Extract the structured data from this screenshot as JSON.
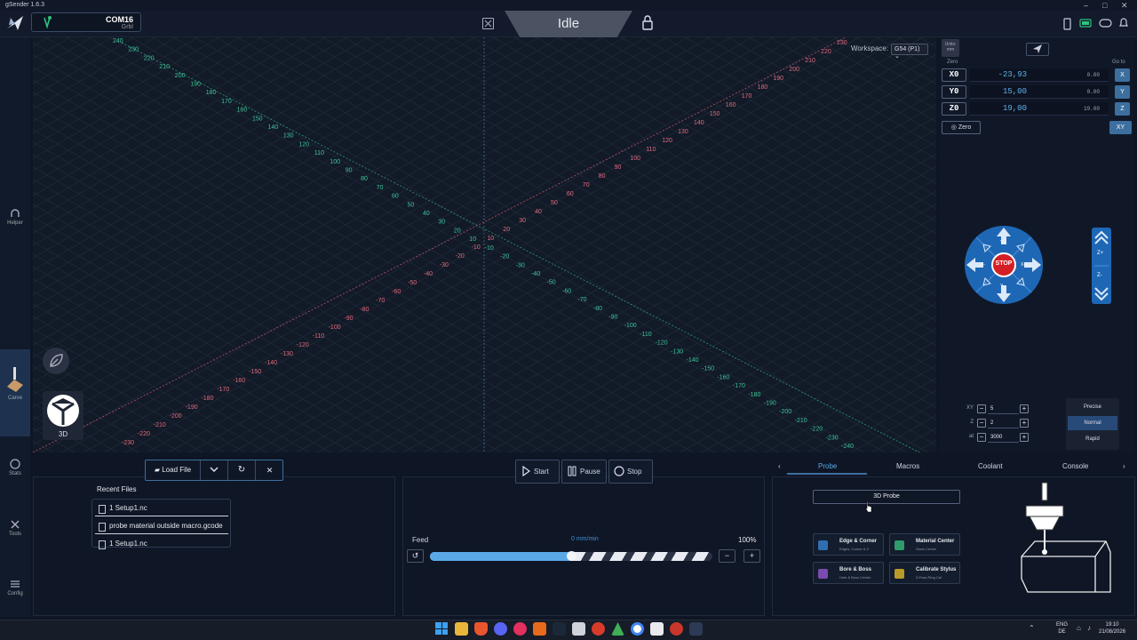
{
  "window": {
    "title": "gSender 1.6.3",
    "controls": {
      "minimize": "–",
      "maximize": "□",
      "close": "✕"
    }
  },
  "connection": {
    "port": "COM16",
    "firmware": "Grbl"
  },
  "status": {
    "state": "Idle"
  },
  "sidebar": {
    "items": [
      {
        "label": "Helper"
      },
      {
        "label": "Carve"
      },
      {
        "label": "Stats"
      },
      {
        "label": "Tools"
      },
      {
        "label": "Config"
      }
    ]
  },
  "viewport": {
    "workspace_label": "Workspace:",
    "workspace_value": "G54 (P1)",
    "view_mode": "3D",
    "axis_ticks_left": [
      "240",
      "230",
      "220",
      "210",
      "200",
      "190",
      "180",
      "170",
      "160",
      "150",
      "140",
      "130",
      "120",
      "110",
      "100",
      "90",
      "80",
      "70",
      "60",
      "50",
      "40",
      "30",
      "20",
      "10",
      "-10",
      "-20",
      "-30",
      "-40",
      "-50",
      "-60",
      "-70",
      "-80",
      "-90",
      "-100",
      "-110",
      "-120",
      "-130",
      "-140",
      "-150",
      "-160",
      "-170",
      "-180",
      "-190",
      "-200",
      "-210",
      "-220",
      "-230",
      "-240"
    ],
    "axis_ticks_right": [
      "230",
      "220",
      "210",
      "200",
      "190",
      "180",
      "170",
      "160",
      "150",
      "140",
      "130",
      "120",
      "110",
      "100",
      "90",
      "80",
      "70",
      "60",
      "50",
      "40",
      "30",
      "20",
      "10",
      "-10",
      "-20",
      "-30",
      "-40",
      "-50",
      "-60",
      "-70",
      "-80",
      "-90",
      "-100",
      "-110",
      "-120",
      "-130",
      "-140",
      "-150",
      "-160",
      "-170",
      "-180",
      "-190",
      "-200",
      "-210",
      "-220",
      "-230"
    ]
  },
  "dro": {
    "units_label": "Units: mm",
    "zero_label": "Zero",
    "goto_label": "Go to",
    "axes": [
      {
        "label": "X0",
        "machine": "-23,93",
        "work": "0.00",
        "goto": "X"
      },
      {
        "label": "Y0",
        "machine": "15,00",
        "work": "0.00",
        "goto": "Y"
      },
      {
        "label": "Z0",
        "machine": "19,00",
        "work": "19.00",
        "goto": "Z"
      }
    ],
    "zero_button": "Zero",
    "goto_xy": "XY"
  },
  "jog": {
    "stop_label": "STOP",
    "x_plus": "X+",
    "x_minus": "X-",
    "y_plus": "Y+",
    "y_minus": "Y-",
    "z_plus": "Z+",
    "z_minus": "Z-",
    "steps": [
      {
        "label": "XY",
        "value": "5"
      },
      {
        "label": "Z",
        "value": "2"
      },
      {
        "label": "at",
        "value": "3000"
      }
    ],
    "speeds": [
      "Precise",
      "Normal",
      "Rapid"
    ],
    "active_speed": "Normal"
  },
  "file": {
    "load_label": "Load File",
    "recent_title": "Recent Files",
    "recent": [
      "1 Setup1.nc",
      "probe material outside macro.gcode",
      "1 Setup1.nc"
    ]
  },
  "job": {
    "start": "Start",
    "pause": "Pause",
    "stop": "Stop",
    "feed_label": "Feed",
    "feed_rate": "0 mm/min",
    "feed_percent": "100%",
    "feed_override": 0.5,
    "minus": "−",
    "plus": "+"
  },
  "tools_tabs": {
    "tabs": [
      "Probe",
      "Macros",
      "Coolant",
      "Console"
    ],
    "active": "Probe"
  },
  "probe": {
    "probe_3d_label": "3D Probe",
    "options": [
      {
        "title": "Edge & Corner",
        "subtitle": "Edges, Corner & Z",
        "color": "#2f6fb0"
      },
      {
        "title": "Material Center",
        "subtitle": "Stock Center",
        "color": "#2f9a6b"
      },
      {
        "title": "Bore & Boss",
        "subtitle": "Hole & Boss Center",
        "color": "#7a4bb0"
      },
      {
        "title": "Calibrate Stylus",
        "subtitle": "3-Pass Ring Cal",
        "color": "#b89a2a"
      }
    ]
  },
  "taskbar": {
    "lang": "ENG",
    "region": "DE",
    "time": "19:10",
    "date": "21/08/2026"
  },
  "colors": {
    "accent": "#3d6f9e",
    "stop": "#d41f26",
    "jog_blue": "#1e67b5",
    "x_axis": "#e06b7e",
    "y_axis": "#3ec49a"
  }
}
